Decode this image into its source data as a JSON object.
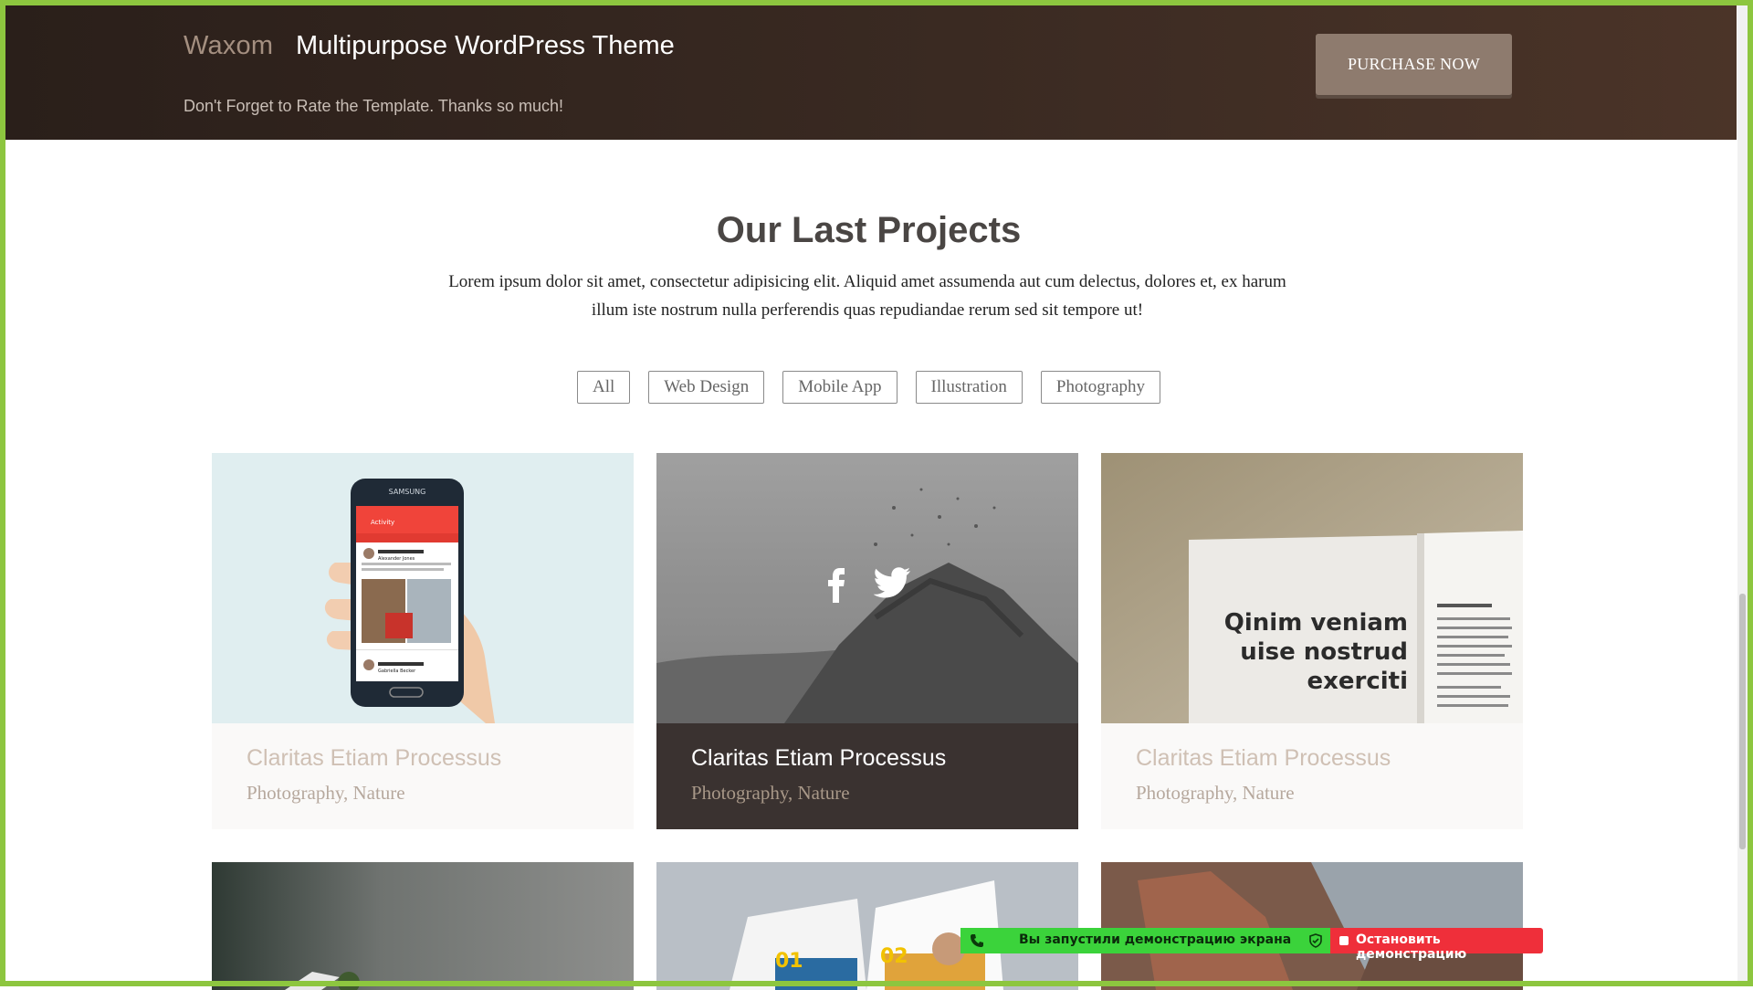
{
  "header": {
    "brand": "Waxom",
    "tagline": "Multipurpose WordPress Theme",
    "subline": "Don't Forget to Rate the Template. Thanks so much!",
    "purchase_label": "PURCHASE NOW"
  },
  "section": {
    "title": "Our Last Projects",
    "lead": "Lorem ipsum dolor sit amet, consectetur adipisicing elit. Aliquid amet assumenda aut cum delectus, dolores et, ex harum illum iste nostrum nulla perferendis quas repudiandae rerum sed sit tempore ut!"
  },
  "filters": [
    "All",
    "Web Design",
    "Mobile App",
    "Illustration",
    "Photography"
  ],
  "projects": [
    {
      "title": "Claritas Etiam Processus",
      "subtitle": "Photography, Nature"
    },
    {
      "title": "Claritas Etiam Processus",
      "subtitle": "Photography, Nature"
    },
    {
      "title": "Claritas Etiam Processus",
      "subtitle": "Photography, Nature"
    }
  ],
  "magazine_text": "Qinim veniam uise nostrud exerciti",
  "phone_brand": "SAMSUNG",
  "phone_app_title": "Activity",
  "phone_user": "Alexander Jones",
  "phone_user2": "Gabriella Becker",
  "banner": {
    "status": "Вы запустили демонстрацию экрана",
    "stop": "Остановить демонстрацию"
  },
  "colors": {
    "frame": "#8dc63f",
    "header_dark": "#2a1f1a",
    "purchase": "#8e7b6e",
    "caption_active": "#3a3230",
    "banner_green": "#3bd33b",
    "banner_red": "#ef2f3a"
  }
}
